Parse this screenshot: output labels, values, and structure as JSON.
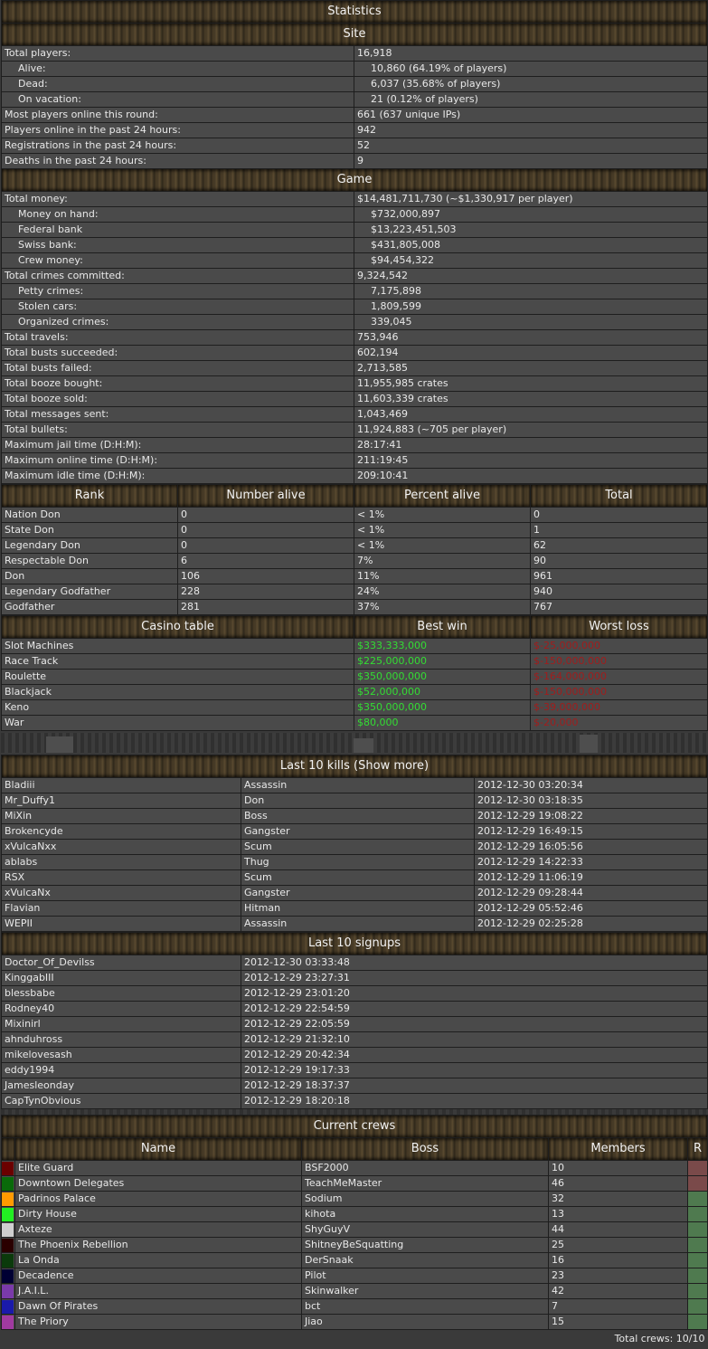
{
  "statistics_title": "Statistics",
  "site": {
    "header": "Site",
    "rows": [
      {
        "label": "Total players:",
        "value": "16,918",
        "sub": false
      },
      {
        "label": "Alive:",
        "value": "10,860 (64.19% of players)",
        "sub": true
      },
      {
        "label": "Dead:",
        "value": "6,037 (35.68% of players)",
        "sub": true
      },
      {
        "label": "On vacation:",
        "value": "21 (0.12% of players)",
        "sub": true
      },
      {
        "label": "Most players online this round:",
        "value": "661 (637 unique IPs)",
        "sub": false
      },
      {
        "label": "Players online in the past 24 hours:",
        "value": "942",
        "sub": false
      },
      {
        "label": "Registrations in the past 24 hours:",
        "value": "52",
        "sub": false
      },
      {
        "label": "Deaths in the past 24 hours:",
        "value": "9",
        "sub": false
      }
    ]
  },
  "game": {
    "header": "Game",
    "rows": [
      {
        "label": "Total money:",
        "value": "$14,481,711,730 (~$1,330,917 per player)",
        "sub": false
      },
      {
        "label": "Money on hand:",
        "value": "$732,000,897",
        "sub": true
      },
      {
        "label": "Federal bank",
        "value": "$13,223,451,503",
        "sub": true
      },
      {
        "label": "Swiss bank:",
        "value": "$431,805,008",
        "sub": true
      },
      {
        "label": "Crew money:",
        "value": "$94,454,322",
        "sub": true
      },
      {
        "label": "Total crimes committed:",
        "value": "9,324,542",
        "sub": false
      },
      {
        "label": "Petty crimes:",
        "value": "7,175,898",
        "sub": true
      },
      {
        "label": "Stolen cars:",
        "value": "1,809,599",
        "sub": true
      },
      {
        "label": "Organized crimes:",
        "value": "339,045",
        "sub": true
      },
      {
        "label": "Total travels:",
        "value": "753,946",
        "sub": false
      },
      {
        "label": "Total busts succeeded:",
        "value": "602,194",
        "sub": false
      },
      {
        "label": "Total busts failed:",
        "value": "2,713,585",
        "sub": false
      },
      {
        "label": "Total booze bought:",
        "value": "11,955,985 crates",
        "sub": false
      },
      {
        "label": "Total booze sold:",
        "value": "11,603,339 crates",
        "sub": false
      },
      {
        "label": "Total messages sent:",
        "value": "1,043,469",
        "sub": false
      },
      {
        "label": "Total bullets:",
        "value": "11,924,883 (~705 per player)",
        "sub": false
      },
      {
        "label": "Maximum jail time (D:H:M):",
        "value": "28:17:41",
        "sub": false
      },
      {
        "label": "Maximum online time (D:H:M):",
        "value": "211:19:45",
        "sub": false
      },
      {
        "label": "Maximum idle time (D:H:M):",
        "value": "209:10:41",
        "sub": false
      }
    ]
  },
  "ranks": {
    "headers": [
      "Rank",
      "Number alive",
      "Percent alive",
      "Total"
    ],
    "rows": [
      [
        "Nation Don",
        "0",
        "< 1%",
        "0"
      ],
      [
        "State Don",
        "0",
        "< 1%",
        "1"
      ],
      [
        "Legendary Don",
        "0",
        "< 1%",
        "62"
      ],
      [
        "Respectable Don",
        "6",
        "7%",
        "90"
      ],
      [
        "Don",
        "106",
        "11%",
        "961"
      ],
      [
        "Legendary Godfather",
        "228",
        "24%",
        "940"
      ],
      [
        "Godfather",
        "281",
        "37%",
        "767"
      ]
    ]
  },
  "casino": {
    "headers": [
      "Casino table",
      "Best win",
      "Worst loss"
    ],
    "rows": [
      [
        "Slot Machines",
        "$333,333,000",
        "$-25,000,000"
      ],
      [
        "Race Track",
        "$225,000,000",
        "$-150,000,000"
      ],
      [
        "Roulette",
        "$350,000,000",
        "$-164,000,000"
      ],
      [
        "Blackjack",
        "$52,000,000",
        "$-150,000,000"
      ],
      [
        "Keno",
        "$350,000,000",
        "$-39,000,000"
      ],
      [
        "War",
        "$80,000",
        "$-20,000"
      ]
    ],
    "win_color": "#33dd33",
    "loss_color": "#a01d1d"
  },
  "kills": {
    "header": "Last 10 kills (Show more)",
    "rows": [
      [
        "Bladiii",
        "Assassin",
        "2012-12-30 03:20:34"
      ],
      [
        "Mr_Duffy1",
        "Don",
        "2012-12-30 03:18:35"
      ],
      [
        "MiXin",
        "Boss",
        "2012-12-29 19:08:22"
      ],
      [
        "Brokencyde",
        "Gangster",
        "2012-12-29 16:49:15"
      ],
      [
        "xVulcaNxx",
        "Scum",
        "2012-12-29 16:05:56"
      ],
      [
        "ablabs",
        "Thug",
        "2012-12-29 14:22:33"
      ],
      [
        "RSX",
        "Scum",
        "2012-12-29 11:06:19"
      ],
      [
        "xVulcaNx",
        "Gangster",
        "2012-12-29 09:28:44"
      ],
      [
        "Flavian",
        "Hitman",
        "2012-12-29 05:52:46"
      ],
      [
        "WEPII",
        "Assassin",
        "2012-12-29 02:25:28"
      ]
    ]
  },
  "signups": {
    "header": "Last 10 signups",
    "rows": [
      [
        "Doctor_Of_Devilss",
        "2012-12-30 03:33:48"
      ],
      [
        "KinggabIII",
        "2012-12-29 23:27:31"
      ],
      [
        "blessbabe",
        "2012-12-29 23:01:20"
      ],
      [
        "Rodney40",
        "2012-12-29 22:54:59"
      ],
      [
        "Mixinirl",
        "2012-12-29 22:05:59"
      ],
      [
        "ahnduhross",
        "2012-12-29 21:32:10"
      ],
      [
        "mikelovesash",
        "2012-12-29 20:42:34"
      ],
      [
        "eddy1994",
        "2012-12-29 19:17:33"
      ],
      [
        "Jamesleonday",
        "2012-12-29 18:37:37"
      ],
      [
        "CapTynObvious",
        "2012-12-29 18:20:18"
      ]
    ]
  },
  "crews": {
    "header": "Current crews",
    "headers": [
      "Name",
      "Boss",
      "Members",
      "R"
    ],
    "rows": [
      {
        "color": "#6b0000",
        "name": "Elite Guard",
        "boss": "BSF2000",
        "members": "10",
        "r": "#7a4a4a"
      },
      {
        "color": "#0a6a0a",
        "name": "Downtown Delegates",
        "boss": "TeachMeMaster",
        "members": "46",
        "r": "#7a4a4a"
      },
      {
        "color": "#ff9a00",
        "name": "Padrinos Palace",
        "boss": "Sodium",
        "members": "32",
        "r": "#4f7a4f"
      },
      {
        "color": "#22ee22",
        "name": "Dirty House",
        "boss": "kihota",
        "members": "13",
        "r": "#4f7a4f"
      },
      {
        "color": "#cfcfcf",
        "name": "Axteze",
        "boss": "ShyGuyV",
        "members": "44",
        "r": "#4f7a4f"
      },
      {
        "color": "#2a0000",
        "name": "The Phoenix Rebellion",
        "boss": "ShitneyBeSquatting",
        "members": "25",
        "r": "#4f7a4f"
      },
      {
        "color": "#0b3a0b",
        "name": "La Onda",
        "boss": "DerSnaak",
        "members": "16",
        "r": "#4f7a4f"
      },
      {
        "color": "#000033",
        "name": "Decadence",
        "boss": "Pilot",
        "members": "23",
        "r": "#4f7a4f"
      },
      {
        "color": "#7a3aaa",
        "name": "J.A.I.L.",
        "boss": "Skinwalker",
        "members": "42",
        "r": "#4f7a4f"
      },
      {
        "color": "#1a1aaa",
        "name": "Dawn Of Pirates",
        "boss": "bct",
        "members": "7",
        "r": "#4f7a4f"
      },
      {
        "color": "#a03aa0",
        "name": "The Priory",
        "boss": "Jiao",
        "members": "15",
        "r": "#4f7a4f"
      }
    ],
    "total": "Total crews: 10/10"
  }
}
